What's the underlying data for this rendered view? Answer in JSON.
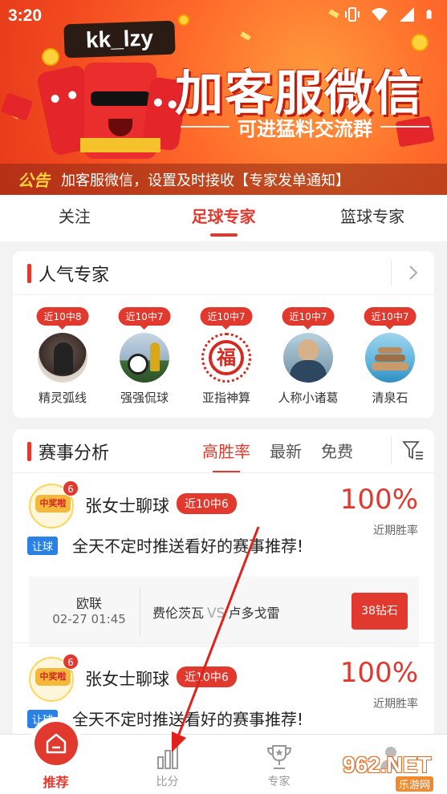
{
  "status_bar": {
    "time": "3:20"
  },
  "banner": {
    "badge": "kk_lzy",
    "title": "加客服微信",
    "subtitle": "可进猛料交流群",
    "notice_tag": "公告",
    "notice_text": "加客服微信，设置及时接收【专家发单通知】"
  },
  "tabs": [
    {
      "label": "关注"
    },
    {
      "label": "足球专家"
    },
    {
      "label": "篮球专家"
    }
  ],
  "experts_section": {
    "title": "人气专家",
    "more_icon": "chevron-right-icon",
    "experts": [
      {
        "badge": "近10中8",
        "name": "精灵弧线"
      },
      {
        "badge": "近10中7",
        "name": "强强侃球"
      },
      {
        "badge": "近10中7",
        "name": "亚指神算"
      },
      {
        "badge": "近10中7",
        "name": "人称小诸葛"
      },
      {
        "badge": "近10中7",
        "name": "清泉石"
      }
    ]
  },
  "analysis_section": {
    "title": "赛事分析",
    "filters": [
      {
        "label": "高胜率"
      },
      {
        "label": "最新"
      },
      {
        "label": "免费"
      }
    ],
    "filter_icon": "filter-icon",
    "posts": [
      {
        "avatar_text": "中奖啦",
        "count": "6",
        "name": "张女士聊球",
        "streak": "近10中6",
        "rate": "100%",
        "rate_label": "近期胜率",
        "tag": "让球",
        "desc": "全天不定时推送看好的赛事推荐!",
        "match": {
          "league": "欧联",
          "time": "02-27 01:45",
          "home": "费伦茨瓦",
          "vs": "VS",
          "away": "卢多戈雷",
          "price": "38钻石"
        }
      },
      {
        "avatar_text": "中奖啦",
        "count": "6",
        "name": "张女士聊球",
        "streak": "近10中6",
        "rate": "100%",
        "rate_label": "近期胜率",
        "tag": "让球",
        "desc": "全天不定时推送看好的赛事推荐!"
      }
    ]
  },
  "bottom_nav": [
    {
      "label": "推荐",
      "icon": "home-icon"
    },
    {
      "label": "比分",
      "icon": "bar-chart-icon"
    },
    {
      "label": "专家",
      "icon": "trophy-icon"
    },
    {
      "label": "",
      "icon": "profile-icon"
    }
  ],
  "watermark": {
    "big": "962.NET",
    "small": "乐游网"
  },
  "colors": {
    "accent": "#e2392e",
    "tag_blue": "#2b80e6",
    "banner": "#f24a1f"
  }
}
